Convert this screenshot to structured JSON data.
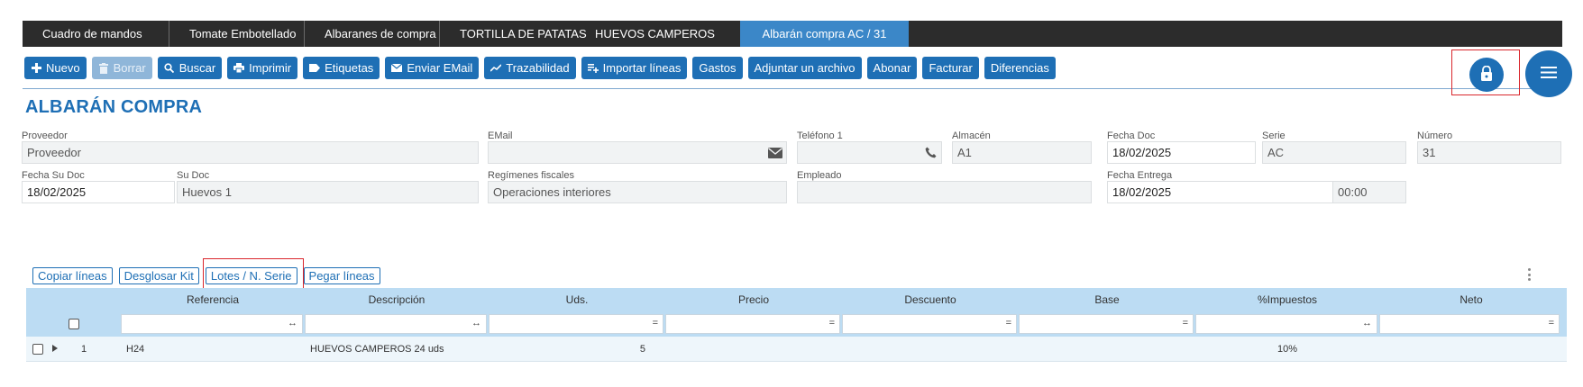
{
  "tabs": [
    {
      "label": "Cuadro de mandos"
    },
    {
      "label": "Tomate Embotellado"
    },
    {
      "label": "Albaranes de compra"
    },
    {
      "label": "TORTILLA DE PATATAS"
    },
    {
      "label": "HUEVOS CAMPEROS"
    },
    {
      "label": "Albarán compra AC / 31"
    }
  ],
  "toolbar": {
    "nuevo": "Nuevo",
    "borrar": "Borrar",
    "buscar": "Buscar",
    "imprimir": "Imprimir",
    "etiquetas": "Etiquetas",
    "enviar_email": "Enviar EMail",
    "trazabilidad": "Trazabilidad",
    "importar_lineas": "Importar líneas",
    "gastos": "Gastos",
    "adjuntar": "Adjuntar un archivo",
    "abonar": "Abonar",
    "facturar": "Facturar",
    "diferencias": "Diferencias"
  },
  "page_title": "ALBARÁN COMPRA",
  "form": {
    "proveedor": {
      "label": "Proveedor",
      "value": "Proveedor"
    },
    "email": {
      "label": "EMail",
      "value": ""
    },
    "telefono": {
      "label": "Teléfono 1",
      "value": ""
    },
    "almacen": {
      "label": "Almacén",
      "value": "A1"
    },
    "fecha_doc": {
      "label": "Fecha Doc",
      "value": "18/02/2025"
    },
    "serie": {
      "label": "Serie",
      "value": "AC"
    },
    "numero": {
      "label": "Número",
      "value": "31"
    },
    "fecha_su_doc": {
      "label": "Fecha Su Doc",
      "value": "18/02/2025"
    },
    "su_doc": {
      "label": "Su Doc",
      "value": "Huevos 1"
    },
    "regimenes": {
      "label": "Regímenes fiscales",
      "value": "Operaciones interiores"
    },
    "empleado": {
      "label": "Empleado",
      "value": ""
    },
    "fecha_entrega": {
      "label": "Fecha Entrega",
      "value": "18/02/2025",
      "time": "00:00"
    }
  },
  "grid_actions": {
    "copiar": "Copiar líneas",
    "desglosar": "Desglosar Kit",
    "lotes": "Lotes / N. Serie",
    "pegar": "Pegar líneas"
  },
  "grid": {
    "columns": [
      "Referencia",
      "Descripción",
      "Uds.",
      "Precio",
      "Descuento",
      "Base",
      "%Impuestos",
      "Neto"
    ],
    "filter_ops": [
      "↔",
      "↔",
      "=",
      "=",
      "=",
      "=",
      "↔",
      "="
    ],
    "rows": [
      {
        "num": "1",
        "referencia": "H24",
        "descripcion": "HUEVOS CAMPEROS 24 uds",
        "uds": "5",
        "precio": "",
        "descuento": "",
        "base": "",
        "impuestos": "10%",
        "neto": ""
      }
    ]
  },
  "colors": {
    "primary": "#1e6fb5",
    "header_bg": "#2c2c2c",
    "active_tab": "#3b87c8",
    "grid_header": "#bcdcf3",
    "highlight": "#d9262c"
  }
}
